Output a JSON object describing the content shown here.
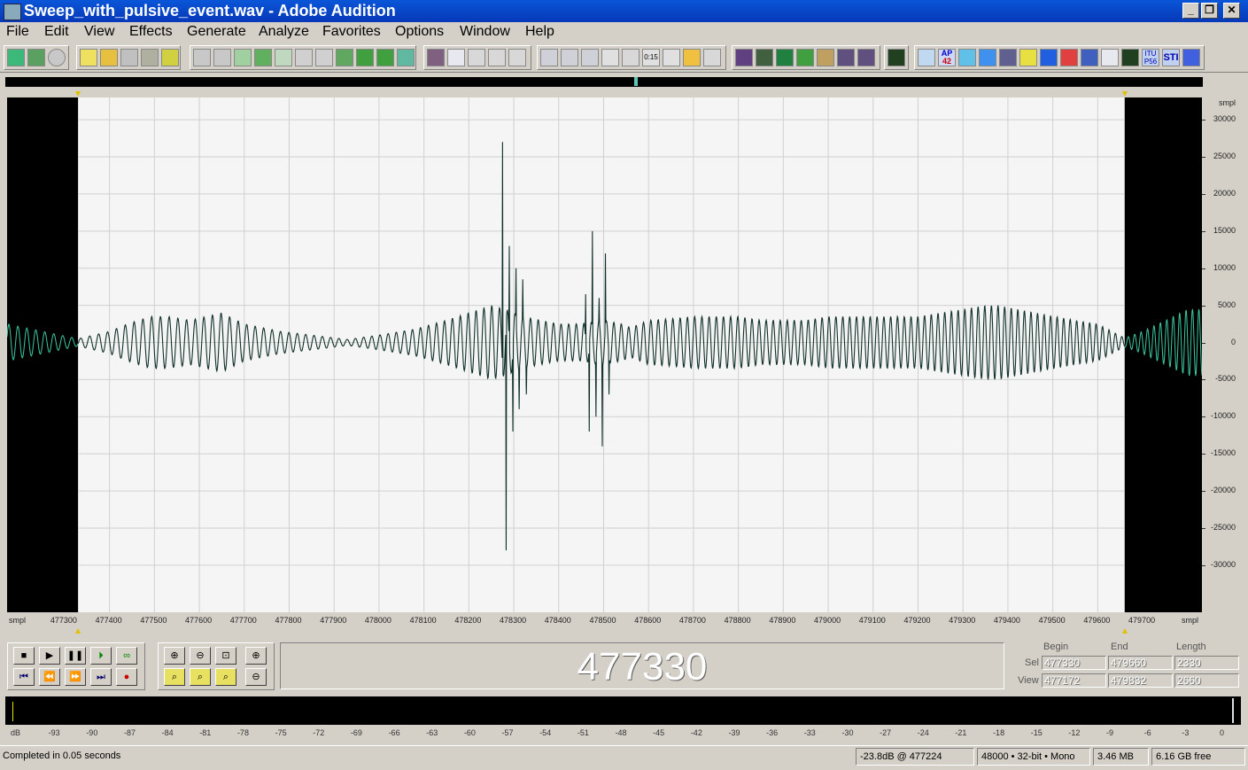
{
  "window": {
    "title": "Sweep_with_pulsive_event.wav - Adobe Audition",
    "controls": [
      "_",
      "❐",
      "✕"
    ]
  },
  "menu": [
    "File",
    "Edit",
    "View",
    "Effects",
    "Generate",
    "Analyze",
    "Favorites",
    "Options",
    "Window",
    "Help"
  ],
  "toolbar_labels": {
    "counter": "0:15",
    "ap": "AP",
    "ap_num": "42",
    "itu": "ITU",
    "p56": "P56",
    "sti": "STI"
  },
  "colors": {
    "waveform_selected": "#12302a",
    "waveform_unselected": "#3dc8a0",
    "selection_bg": "#f4f5f4",
    "unselected_bg": "#000000",
    "grid": "#d0d0d0"
  },
  "chart_data": {
    "type": "line",
    "x_unit": "smpl",
    "y_unit": "smpl",
    "x_range": [
      477172,
      479832
    ],
    "y_range": [
      -33000,
      33000
    ],
    "selection": [
      477330,
      479660
    ],
    "xticks": [
      477300,
      477400,
      477500,
      477600,
      477700,
      477800,
      477900,
      478000,
      478100,
      478200,
      478300,
      478400,
      478500,
      478600,
      478700,
      478800,
      478900,
      479000,
      479100,
      479200,
      479300,
      479400,
      479500,
      479600,
      479700
    ],
    "yticks": [
      30000,
      25000,
      20000,
      15000,
      10000,
      5000,
      0,
      -5000,
      -10000,
      -15000,
      -20000,
      -25000,
      -30000
    ],
    "envelope": {
      "x": [
        477172,
        477330,
        477400,
        477440,
        477490,
        477530,
        477580,
        477650,
        477700,
        477780,
        477850,
        477930,
        478000,
        478080,
        478150,
        478200,
        478250,
        478280,
        478320,
        478360,
        478400,
        478450,
        478500,
        478540,
        478560,
        478600,
        478650,
        478700,
        478750,
        478800,
        478850,
        478900,
        478950,
        479000,
        479100,
        479200,
        479300,
        479350,
        479380,
        479420,
        479480,
        479550,
        479600,
        479660,
        479700,
        479750,
        479800,
        479832
      ],
      "amp": [
        2500,
        500,
        1500,
        2500,
        3500,
        3500,
        3000,
        4000,
        2500,
        1500,
        1000,
        400,
        1000,
        1800,
        3000,
        4000,
        5000,
        4500,
        3500,
        3000,
        2500,
        2500,
        3000,
        2500,
        2000,
        3000,
        3200,
        3500,
        3500,
        3500,
        3000,
        3000,
        3000,
        3500,
        3500,
        3500,
        4500,
        5000,
        5000,
        4500,
        3800,
        3000,
        2500,
        600,
        1500,
        3000,
        4500,
        4500
      ]
    },
    "freq_hz_at": {
      "x": [
        477172,
        477330,
        478000,
        478500,
        479000,
        479660,
        479832
      ],
      "cycles_per_sample": [
        0.05,
        0.05,
        0.055,
        0.06,
        0.065,
        0.07,
        0.07
      ]
    },
    "spikes": [
      {
        "x": 478275,
        "y": 27000
      },
      {
        "x": 478283,
        "y": -28000
      },
      {
        "x": 478290,
        "y": 13000
      },
      {
        "x": 478298,
        "y": -12000
      },
      {
        "x": 478305,
        "y": 10000
      },
      {
        "x": 478312,
        "y": -9000
      },
      {
        "x": 478320,
        "y": 8500
      },
      {
        "x": 478328,
        "y": -7000
      },
      {
        "x": 478460,
        "y": 6500
      },
      {
        "x": 478468,
        "y": -12000
      },
      {
        "x": 478475,
        "y": 15000
      },
      {
        "x": 478483,
        "y": -10000
      },
      {
        "x": 478490,
        "y": 6000
      },
      {
        "x": 478497,
        "y": -14000
      },
      {
        "x": 478504,
        "y": 12000
      },
      {
        "x": 478512,
        "y": -7000
      }
    ]
  },
  "transport": {
    "time_display": "477330"
  },
  "selection_panel": {
    "headers": [
      "Begin",
      "End",
      "Length"
    ],
    "sel_label": "Sel",
    "view_label": "View",
    "sel": [
      "477330",
      "479660",
      "2330"
    ],
    "view": [
      "477172",
      "479832",
      "2660"
    ]
  },
  "level_meter_ticks": [
    "dB",
    "-93",
    "-90",
    "-87",
    "-84",
    "-81",
    "-78",
    "-75",
    "-72",
    "-69",
    "-66",
    "-63",
    "-60",
    "-57",
    "-54",
    "-51",
    "-48",
    "-45",
    "-42",
    "-39",
    "-36",
    "-33",
    "-30",
    "-27",
    "-24",
    "-21",
    "-18",
    "-15",
    "-12",
    "-9",
    "-6",
    "-3",
    "0"
  ],
  "status": {
    "message": "Completed in 0.05 seconds",
    "cursor": "-23.8dB @ 477224",
    "format": "48000 • 32-bit • Mono",
    "size": "3.46 MB",
    "free": "6.16 GB free"
  },
  "ruler_unit": "smpl"
}
